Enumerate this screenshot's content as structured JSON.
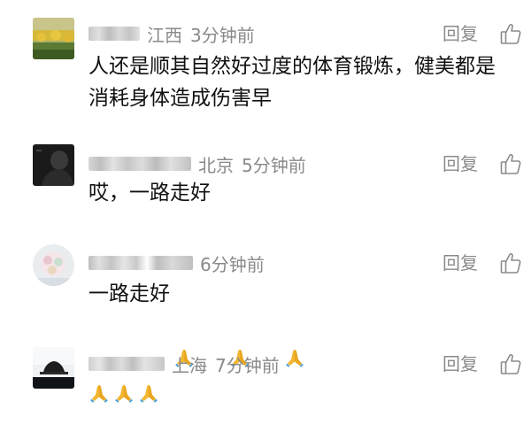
{
  "comments": [
    {
      "location": "江西",
      "time": "3分钟前",
      "text": "人还是顺其自然好过度的体育锻炼，健美都是消耗身体造成伤害早",
      "reply_label": "回复"
    },
    {
      "location": "北京",
      "time": "5分钟前",
      "text": "哎，一路走好",
      "reply_label": "回复"
    },
    {
      "location": "",
      "time": "6分钟前",
      "text": "一路走好",
      "emoji": [
        "pray-icon",
        "pray-icon",
        "pray-icon"
      ],
      "reply_label": "回复"
    },
    {
      "location": "上海",
      "time": "7分钟前",
      "text": "",
      "emoji": [
        "pray-icon",
        "pray-icon",
        "pray-icon"
      ],
      "reply_label": "回复"
    }
  ],
  "colors": {
    "meta_gray": "#8a8a8a",
    "text": "#111111",
    "emoji_yellow": "#f2b630"
  }
}
